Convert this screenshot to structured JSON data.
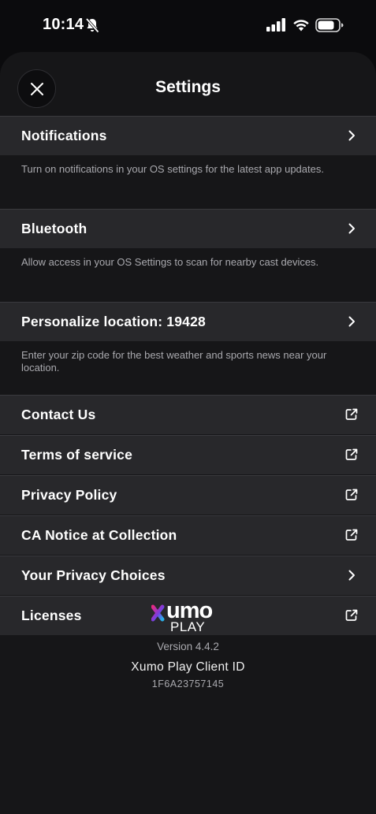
{
  "status_bar": {
    "time": "10:14"
  },
  "header": {
    "title": "Settings"
  },
  "settings": {
    "notifications": {
      "label": "Notifications",
      "description": "Turn on notifications in your OS settings for the latest app updates."
    },
    "bluetooth": {
      "label": "Bluetooth",
      "description": "Allow access in your OS Settings to scan for nearby cast devices."
    },
    "location": {
      "label": "Personalize location: 19428",
      "description": "Enter your zip code for the best weather and sports news near your location."
    }
  },
  "links": [
    {
      "label": "Contact Us",
      "icon": "external-link-icon"
    },
    {
      "label": "Terms of service",
      "icon": "external-link-icon"
    },
    {
      "label": "Privacy Policy",
      "icon": "external-link-icon"
    },
    {
      "label": "CA Notice at Collection",
      "icon": "external-link-icon"
    },
    {
      "label": "Your Privacy Choices",
      "icon": "chevron-right-icon"
    },
    {
      "label": "Licenses",
      "icon": "external-link-icon"
    }
  ],
  "footer": {
    "logo_word": "xumo",
    "logo_sub": "PLAY",
    "version": "Version 4.4.2",
    "client_id_label": "Xumo Play Client ID",
    "client_id_value": "1F6A23757145"
  },
  "colors": {
    "background": "#0b0b0d",
    "sheet": "#161618",
    "row": "#28282b",
    "secondary_text": "#a9a9ae",
    "logo_gradient": [
      "#e62a84",
      "#7a3ce0",
      "#2ab0e8"
    ]
  }
}
